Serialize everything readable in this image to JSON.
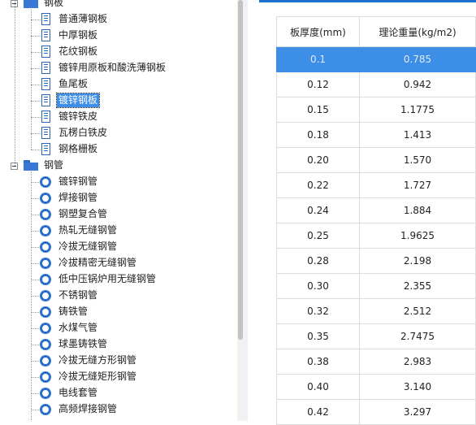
{
  "tree": {
    "cat_plate": "钢板",
    "plate_items": [
      "普通薄钢板",
      "中厚钢板",
      "花纹钢板",
      "镀锌用原板和酸洗薄钢板",
      "鱼尾板",
      "镀锌钢板",
      "镀锌铁皮",
      "瓦楞白铁皮",
      "钢格栅板"
    ],
    "selected_plate": "镀锌钢板",
    "cat_pipe": "钢管",
    "pipe_items": [
      "镀锌钢管",
      "焊接钢管",
      "钢塑复合管",
      "热轧无缝钢管",
      "冷拔无缝钢管",
      "冷拔精密无缝钢管",
      "低中压锅炉用无缝钢管",
      "不锈钢管",
      "铸铁管",
      "水煤气管",
      "球墨铸铁管",
      "冷拔无缝方形钢管",
      "冷拔无缝矩形钢管",
      "电线套管",
      "高频焊接钢管"
    ]
  },
  "table": {
    "col1": "板厚度(mm)",
    "col2": "理论重量(kg/m2)",
    "selected_row": 0,
    "rows": [
      [
        "0.1",
        "0.785"
      ],
      [
        "0.12",
        "0.942"
      ],
      [
        "0.15",
        "1.1775"
      ],
      [
        "0.18",
        "1.413"
      ],
      [
        "0.20",
        "1.570"
      ],
      [
        "0.22",
        "1.727"
      ],
      [
        "0.24",
        "1.884"
      ],
      [
        "0.25",
        "1.9625"
      ],
      [
        "0.28",
        "2.198"
      ],
      [
        "0.30",
        "2.355"
      ],
      [
        "0.32",
        "2.512"
      ],
      [
        "0.35",
        "2.7475"
      ],
      [
        "0.38",
        "2.983"
      ],
      [
        "0.40",
        "3.140"
      ],
      [
        "0.42",
        "3.297"
      ]
    ]
  },
  "colors": {
    "selection": "#3d8ee6",
    "icon_blue": "#2a6fca",
    "accent_bar": "#1f6fcf"
  }
}
